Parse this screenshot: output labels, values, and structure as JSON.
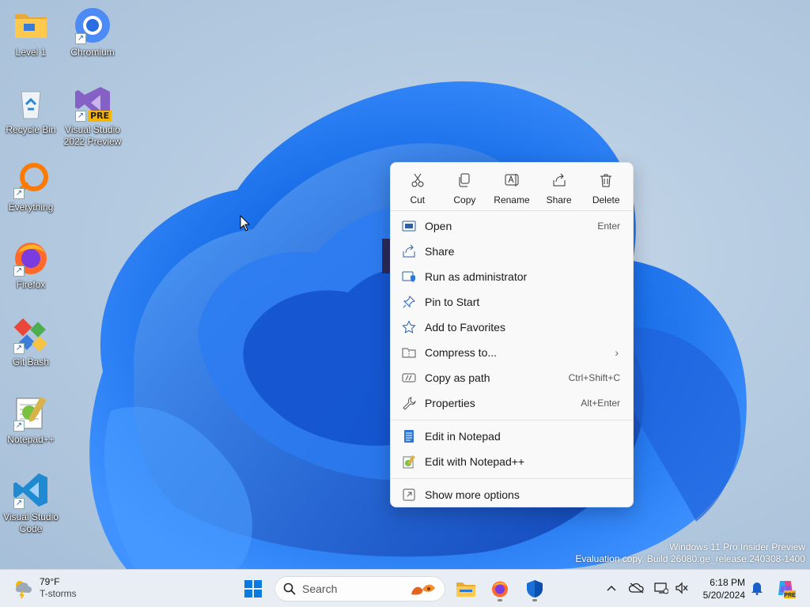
{
  "desktop": {
    "icons": [
      {
        "label": "Level 1",
        "icon": "folder-icon"
      },
      {
        "label": "Chromium",
        "icon": "chromium-icon"
      },
      {
        "label": "Recycle Bin",
        "icon": "recycle-bin-icon"
      },
      {
        "label": "Visual Studio 2022 Preview",
        "icon": "visual-studio-icon",
        "badge": "PRE"
      },
      {
        "label": "Everything",
        "icon": "everything-search-icon"
      },
      {
        "label": "Firefox",
        "icon": "firefox-icon"
      },
      {
        "label": "Git Bash",
        "icon": "git-bash-icon"
      },
      {
        "label": "Notepad++",
        "icon": "notepadpp-icon"
      },
      {
        "label": "Visual Studio Code",
        "icon": "vscode-icon"
      }
    ],
    "watermark": {
      "line1": "Windows 11 Pro Insider Preview",
      "line2": "Evaluation copy. Build 26080.ge_release.240308-1400"
    }
  },
  "context_menu": {
    "quick_actions": [
      {
        "label": "Cut",
        "icon": "scissors-icon"
      },
      {
        "label": "Copy",
        "icon": "copy-icon"
      },
      {
        "label": "Rename",
        "icon": "rename-icon"
      },
      {
        "label": "Share",
        "icon": "share-icon"
      },
      {
        "label": "Delete",
        "icon": "trash-icon"
      }
    ],
    "items": [
      {
        "label": "Open",
        "shortcut": "Enter",
        "icon": "open-window-icon"
      },
      {
        "label": "Share",
        "shortcut": "",
        "icon": "share-icon"
      },
      {
        "label": "Run as administrator",
        "shortcut": "",
        "icon": "shield-icon"
      },
      {
        "label": "Pin to Start",
        "shortcut": "",
        "icon": "pin-icon"
      },
      {
        "label": "Add to Favorites",
        "shortcut": "",
        "icon": "star-icon"
      },
      {
        "label": "Compress to...",
        "shortcut": "",
        "icon": "zip-folder-icon",
        "submenu": "›"
      },
      {
        "label": "Copy as path",
        "shortcut": "Ctrl+Shift+C",
        "icon": "path-icon"
      },
      {
        "label": "Properties",
        "shortcut": "Alt+Enter",
        "icon": "wrench-icon"
      }
    ],
    "app_items": [
      {
        "label": "Edit in Notepad",
        "icon": "notepad-icon"
      },
      {
        "label": "Edit with Notepad++",
        "icon": "notepadpp-icon"
      }
    ],
    "more": {
      "label": "Show more options",
      "icon": "more-options-icon"
    }
  },
  "taskbar": {
    "weather": {
      "temp": "79°F",
      "condition": "T-storms"
    },
    "search_placeholder": "Search",
    "clock": {
      "time": "6:18 PM",
      "date": "5/20/2024"
    },
    "colors": {
      "accent": "#0067c0",
      "taskbar_bg": "#e9eef5"
    }
  }
}
